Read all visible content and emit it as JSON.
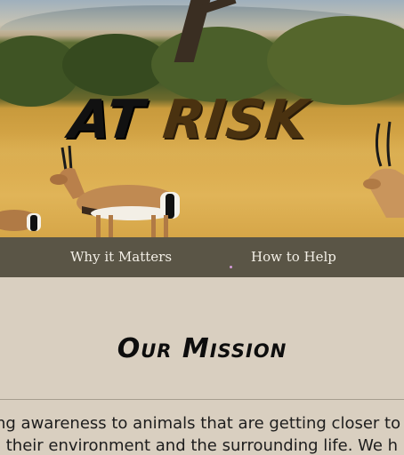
{
  "hero": {
    "title_part1": "AT",
    "title_part2": "RISK"
  },
  "nav": {
    "items": [
      {
        "label": "Why it Matters"
      },
      {
        "label": "How to Help"
      }
    ]
  },
  "mission": {
    "heading": "Our Mission",
    "lines": [
      "ing awareness to animals that are getting closer to",
      "o their environment and the surrounding life. We h"
    ]
  },
  "colors": {
    "nav_bg": "#5a5546",
    "page_bg": "#d9cfc0",
    "title_dark": "#111111",
    "title_brown": "#4a3210"
  }
}
